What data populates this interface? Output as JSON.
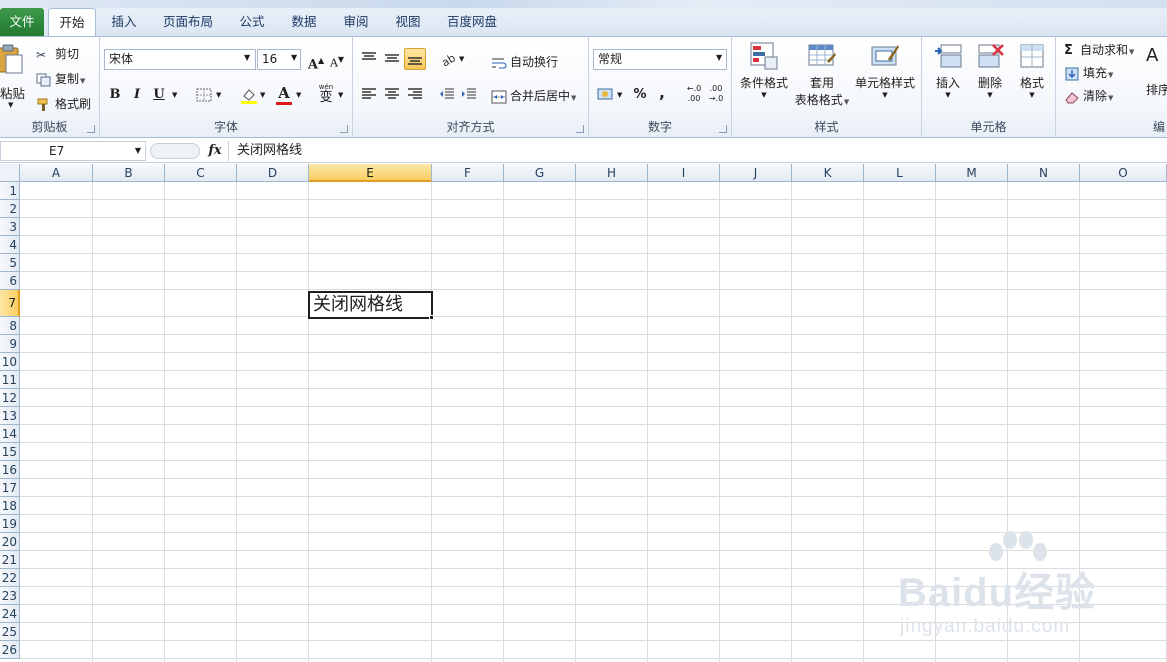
{
  "tabs": {
    "file": "文件",
    "home": "开始",
    "insert": "插入",
    "page_layout": "页面布局",
    "formulas": "公式",
    "data": "数据",
    "review": "审阅",
    "view": "视图",
    "baidu_pan": "百度网盘"
  },
  "ribbon": {
    "clipboard": {
      "paste": "粘贴",
      "cut": "剪切",
      "copy": "复制",
      "format_painter": "格式刷",
      "label": "剪贴板"
    },
    "font": {
      "font_name": "宋体",
      "font_size": "16",
      "grow": "A",
      "shrink": "A",
      "bold": "B",
      "italic": "I",
      "underline": "U",
      "font_color_glyph": "A",
      "phonetic": "wén",
      "phonetic_char": "变",
      "label": "字体"
    },
    "alignment": {
      "wrap_text": "自动换行",
      "merge_center": "合并后居中",
      "label": "对齐方式"
    },
    "number": {
      "format": "常规",
      "percent": "%",
      "comma": ",",
      "inc_decimal": "←.0 .00",
      "dec_decimal": ".00 →.0",
      "label": "数字"
    },
    "styles": {
      "conditional": "条件格式",
      "table_format_line1": "套用",
      "table_format_line2": "表格格式",
      "cell_styles": "单元格样式",
      "label": "样式"
    },
    "cells": {
      "insert": "插入",
      "delete": "删除",
      "format": "格式",
      "label": "单元格"
    },
    "editing": {
      "autosum": "自动求和",
      "fill": "填充",
      "clear": "清除",
      "sort_partial": "排序",
      "label_partial": "编"
    }
  },
  "formula_bar": {
    "name_box": "E7",
    "fx": "fx",
    "content": "关闭网格线"
  },
  "columns": [
    "A",
    "B",
    "C",
    "D",
    "E",
    "F",
    "G",
    "H",
    "I",
    "J",
    "K",
    "L",
    "M",
    "N",
    "O"
  ],
  "rows": [
    "1",
    "2",
    "3",
    "4",
    "5",
    "6",
    "7",
    "8",
    "9",
    "10",
    "11",
    "12",
    "13",
    "14",
    "15",
    "16",
    "17",
    "18",
    "19",
    "20",
    "21",
    "22",
    "23",
    "24",
    "25",
    "26"
  ],
  "selected": {
    "column": "E",
    "row": "7"
  },
  "active_cell_value": "关闭网格线",
  "watermark": {
    "main": "Baidu经验",
    "sub": "jingyan.baidu.com"
  }
}
